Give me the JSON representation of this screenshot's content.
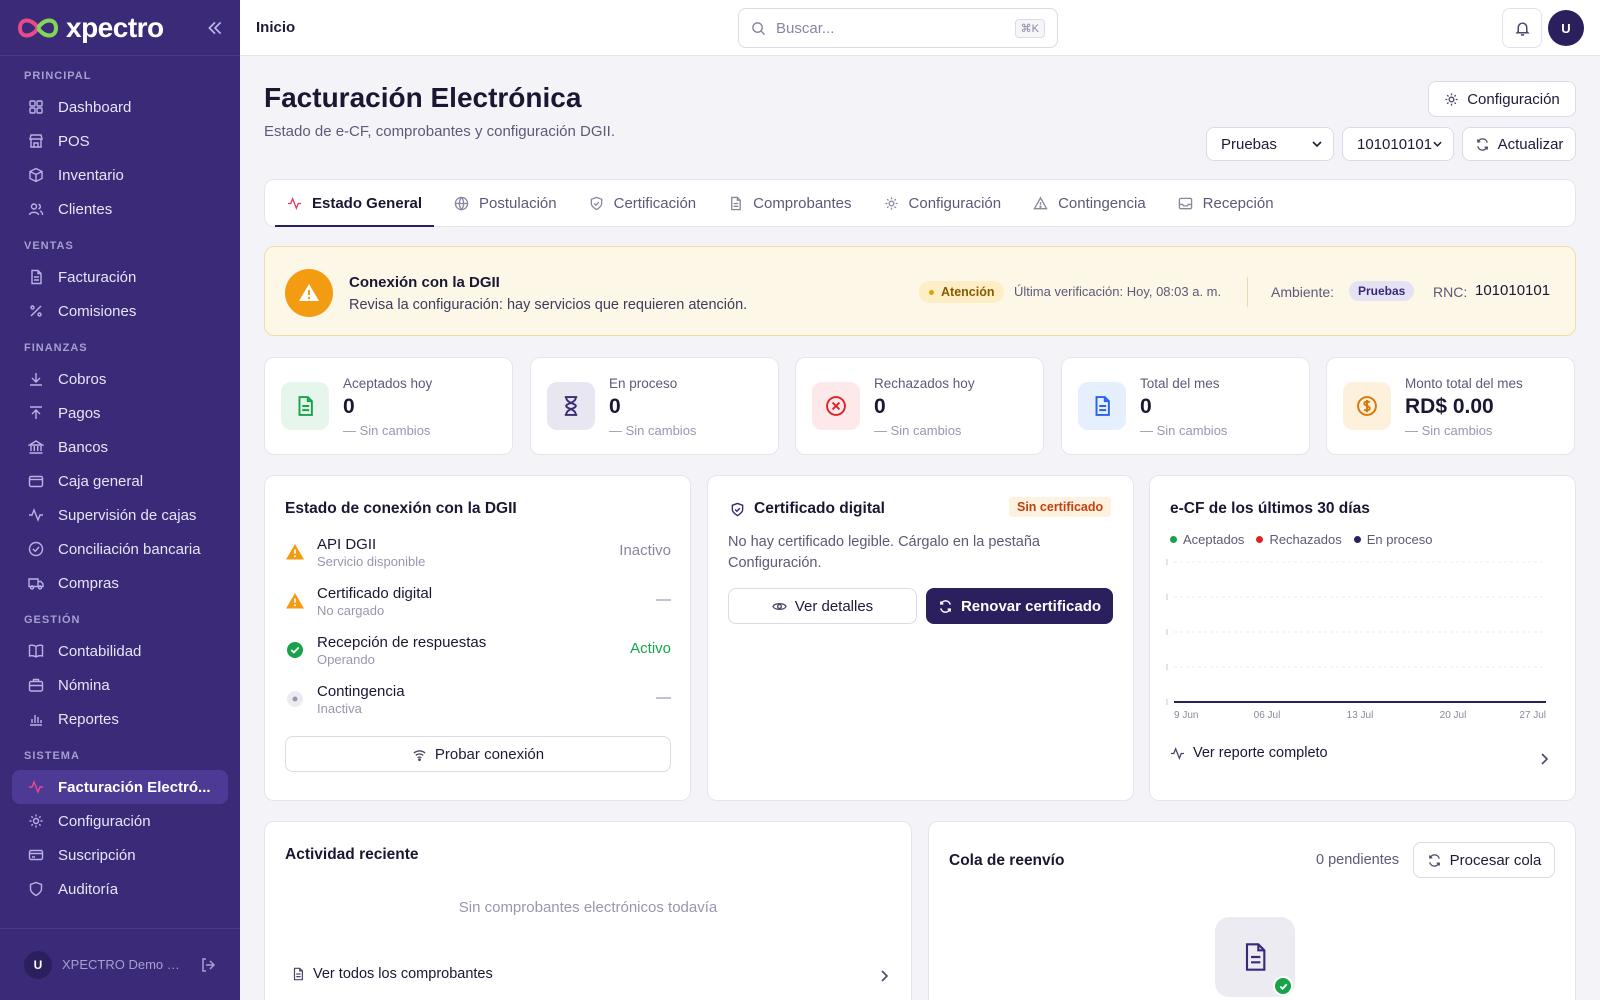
{
  "brand": {
    "name": "xpectro"
  },
  "sidebar": {
    "sections": [
      {
        "title": "PRINCIPAL",
        "items": [
          {
            "label": "Dashboard",
            "icon": "grid-icon"
          },
          {
            "label": "POS",
            "icon": "store-icon"
          },
          {
            "label": "Inventario",
            "icon": "box-icon"
          },
          {
            "label": "Clientes",
            "icon": "users-icon"
          }
        ]
      },
      {
        "title": "VENTAS",
        "items": [
          {
            "label": "Facturación",
            "icon": "file-icon"
          },
          {
            "label": "Comisiones",
            "icon": "percent-icon"
          }
        ]
      },
      {
        "title": "FINANZAS",
        "items": [
          {
            "label": "Cobros",
            "icon": "arrow-down-icon"
          },
          {
            "label": "Pagos",
            "icon": "arrow-up-icon"
          },
          {
            "label": "Bancos",
            "icon": "bank-icon"
          },
          {
            "label": "Caja general",
            "icon": "wallet-icon"
          },
          {
            "label": "Supervisión de cajas",
            "icon": "activity-icon"
          },
          {
            "label": "Conciliación bancaria",
            "icon": "check-circle-icon"
          },
          {
            "label": "Compras",
            "icon": "truck-icon"
          }
        ]
      },
      {
        "title": "GESTIÓN",
        "items": [
          {
            "label": "Contabilidad",
            "icon": "book-icon"
          },
          {
            "label": "Nómina",
            "icon": "briefcase-icon"
          },
          {
            "label": "Reportes",
            "icon": "bar-chart-icon"
          }
        ]
      },
      {
        "title": "SISTEMA",
        "items": [
          {
            "label": "Facturación Electró...",
            "icon": "activity-icon",
            "active": true
          },
          {
            "label": "Configuración",
            "icon": "gear-icon"
          },
          {
            "label": "Suscripción",
            "icon": "card-icon"
          },
          {
            "label": "Auditoría",
            "icon": "shield-icon"
          }
        ]
      }
    ],
    "footer": {
      "initial": "U",
      "name": "XPECTRO Demo S..."
    }
  },
  "topbar": {
    "breadcrumb": "Inicio",
    "search_placeholder": "Buscar...",
    "shortcut": "⌘K",
    "avatar_initial": "U"
  },
  "page": {
    "title": "Facturación Electrónica",
    "subtitle": "Estado de e-CF, comprobantes y configuración DGII.",
    "config_button": "Configuración",
    "env_select": "Pruebas",
    "rnc_select": "101010101",
    "refresh_button": "Actualizar"
  },
  "tabs": [
    {
      "label": "Estado General",
      "icon": "activity-icon",
      "active": true
    },
    {
      "label": "Postulación",
      "icon": "globe-icon"
    },
    {
      "label": "Certificación",
      "icon": "shield-check-icon"
    },
    {
      "label": "Comprobantes",
      "icon": "file-icon"
    },
    {
      "label": "Configuración",
      "icon": "gear-icon"
    },
    {
      "label": "Contingencia",
      "icon": "alert-triangle-icon"
    },
    {
      "label": "Recepción",
      "icon": "inbox-icon"
    }
  ],
  "alert": {
    "title": "Conexión con la DGII",
    "description": "Revisa la configuración: hay servicios que requieren atención.",
    "badge": "Atención",
    "last_check": "Última verificación: Hoy, 08:03 a. m.",
    "ambiente_label": "Ambiente:",
    "ambiente_value": "Pruebas",
    "rnc_label": "RNC:",
    "rnc_value": "101010101"
  },
  "stats": [
    {
      "label": "Aceptados hoy",
      "value": "0",
      "change": "— Sin cambios",
      "icon": "file-text-icon",
      "bg": "#e6f6ec",
      "color": "#16a34a"
    },
    {
      "label": "En proceso",
      "value": "0",
      "change": "— Sin cambios",
      "icon": "hourglass-icon",
      "bg": "#e8e6f0",
      "color": "#3a2a78"
    },
    {
      "label": "Rechazados hoy",
      "value": "0",
      "change": "— Sin cambios",
      "icon": "x-circle-icon",
      "bg": "#fde8ea",
      "color": "#dc2626"
    },
    {
      "label": "Total del mes",
      "value": "0",
      "change": "— Sin cambios",
      "icon": "file-text-icon",
      "bg": "#e6effd",
      "color": "#2563eb"
    },
    {
      "label": "Monto total del mes",
      "value": "RD$ 0.00",
      "change": "— Sin cambios",
      "icon": "dollar-circle-icon",
      "bg": "#fdf1dc",
      "color": "#d97706"
    }
  ],
  "connection": {
    "title": "Estado de conexión con la DGII",
    "services": [
      {
        "name": "API DGII",
        "sub": "Servicio disponible",
        "status": "Inactivo",
        "state": "warning"
      },
      {
        "name": "Certificado digital",
        "sub": "No cargado",
        "status": "—",
        "state": "warning"
      },
      {
        "name": "Recepción de respuestas",
        "sub": "Operando",
        "status": "Activo",
        "state": "ok"
      },
      {
        "name": "Contingencia",
        "sub": "Inactiva",
        "status": "—",
        "state": "idle"
      }
    ],
    "test_button": "Probar conexión"
  },
  "certificate": {
    "title": "Certificado digital",
    "badge": "Sin certificado",
    "description": "No hay certificado legible. Cárgalo en la pestaña Configuración.",
    "details_button": "Ver detalles",
    "renew_button": "Renovar certificado"
  },
  "chart_panel": {
    "title": "e-CF de los últimos 30 días",
    "link": "Ver reporte completo"
  },
  "chart_data": {
    "type": "line",
    "title": "e-CF de los últimos 30 días",
    "x_labels": [
      "9 Jun",
      "06 Jul",
      "13 Jul",
      "20 Jul",
      "27 Jul"
    ],
    "series": [
      {
        "name": "Aceptados",
        "color": "#16a34a",
        "values": [
          0,
          0,
          0,
          0,
          0
        ]
      },
      {
        "name": "Rechazados",
        "color": "#dc2626",
        "values": [
          0,
          0,
          0,
          0,
          0
        ]
      },
      {
        "name": "En proceso",
        "color": "#2b1f5e",
        "values": [
          0,
          0,
          0,
          0,
          0
        ]
      }
    ],
    "ylim": [
      0,
      4
    ],
    "grid": true,
    "legend": "top-left"
  },
  "activity": {
    "title": "Actividad reciente",
    "empty": "Sin comprobantes electrónicos todavía",
    "link": "Ver todos los comprobantes"
  },
  "queue": {
    "title": "Cola de reenvío",
    "pending": "0 pendientes",
    "process_button": "Procesar cola"
  }
}
